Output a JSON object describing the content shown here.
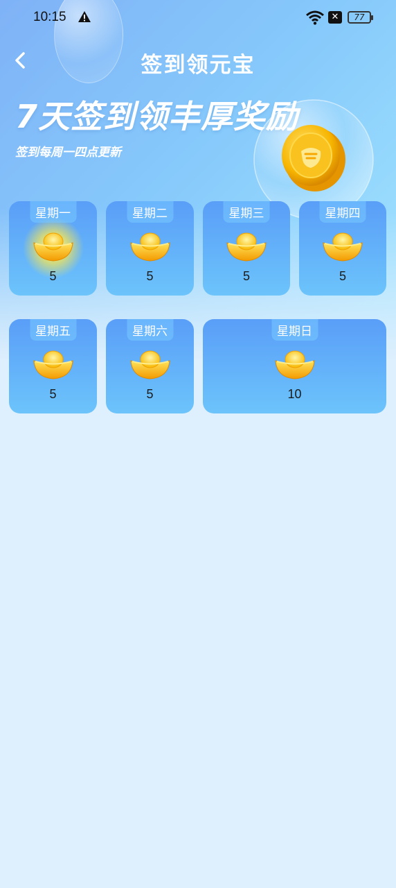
{
  "status_bar": {
    "time": "10:15",
    "battery": "77"
  },
  "nav": {
    "title": "签到领元宝"
  },
  "hero": {
    "title": "7天签到领丰厚奖励",
    "subtitle": "签到每周一四点更新"
  },
  "days": [
    {
      "label": "星期一",
      "reward": "5",
      "highlighted": true
    },
    {
      "label": "星期二",
      "reward": "5",
      "highlighted": false
    },
    {
      "label": "星期三",
      "reward": "5",
      "highlighted": false
    },
    {
      "label": "星期四",
      "reward": "5",
      "highlighted": false
    },
    {
      "label": "星期五",
      "reward": "5",
      "highlighted": false
    },
    {
      "label": "星期六",
      "reward": "5",
      "highlighted": false
    },
    {
      "label": "星期日",
      "reward": "10",
      "highlighted": false
    }
  ],
  "colors": {
    "card_top": "#5a9ef8",
    "card_bottom": "#6cc4fb",
    "page_bg": "#deeffd",
    "gold": "#f7b500"
  }
}
